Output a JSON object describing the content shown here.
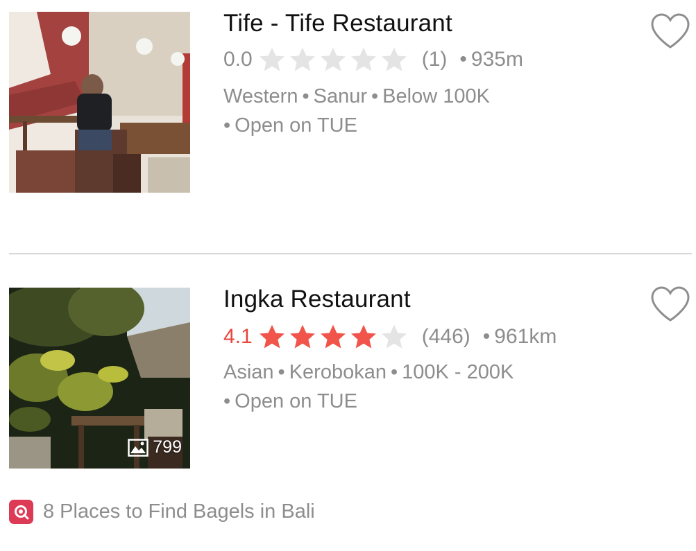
{
  "listings": [
    {
      "name": "Tife - Tife Restaurant",
      "rating": "0.0",
      "stars_filled": 0,
      "review_count": "(1)",
      "distance": "935m",
      "cuisine": "Western",
      "area": "Sanur",
      "price": "Below 100K",
      "open_status": "Open on TUE"
    },
    {
      "name": "Ingka Restaurant",
      "rating": "4.1",
      "stars_filled": 4,
      "review_count": "(446)",
      "distance": "961km",
      "cuisine": "Asian",
      "area": "Kerobokan",
      "price": "100K - 200K",
      "open_status": "Open on TUE",
      "photo_count": "799"
    }
  ],
  "list_link": {
    "label": "8 Places to Find Bagels in Bali"
  },
  "separator": "•",
  "colors": {
    "star_filled": "#f0544a",
    "star_empty": "#e4e4e4",
    "rating_red": "#e8453c",
    "list_badge": "#dd3a55"
  },
  "icons": {
    "favorite": "heart-icon",
    "photos": "image-icon",
    "list": "list-badge-icon"
  }
}
